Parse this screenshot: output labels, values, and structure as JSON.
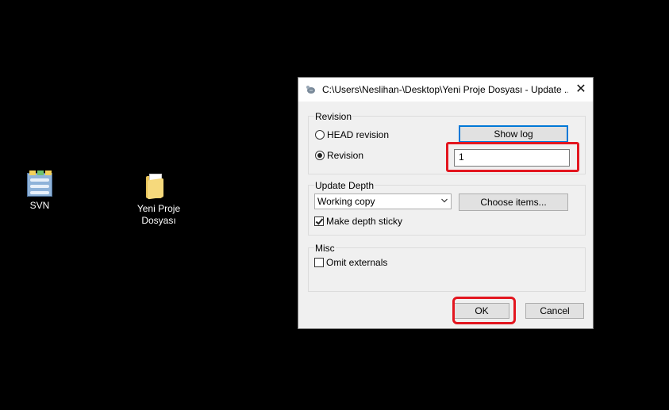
{
  "desktop": {
    "icons": [
      {
        "label": "SVN"
      },
      {
        "label": "Yeni Proje Dosyası"
      }
    ]
  },
  "dialog": {
    "title": "C:\\Users\\Neslihan-\\Desktop\\Yeni Proje Dosyası - Update ...",
    "close": "✕",
    "revision_group": {
      "title": "Revision",
      "head_label": "HEAD revision",
      "revision_label": "Revision",
      "selected": "Revision",
      "show_log": "Show log",
      "revision_value": "1"
    },
    "depth_group": {
      "title": "Update Depth",
      "depth_value": "Working copy",
      "choose_items": "Choose items...",
      "sticky_label": "Make depth sticky",
      "sticky_checked": true
    },
    "misc_group": {
      "title": "Misc",
      "omit_label": "Omit externals",
      "omit_checked": false
    },
    "ok": "OK",
    "cancel": "Cancel"
  },
  "annotations": {
    "highlight_color": "#e3161f"
  }
}
